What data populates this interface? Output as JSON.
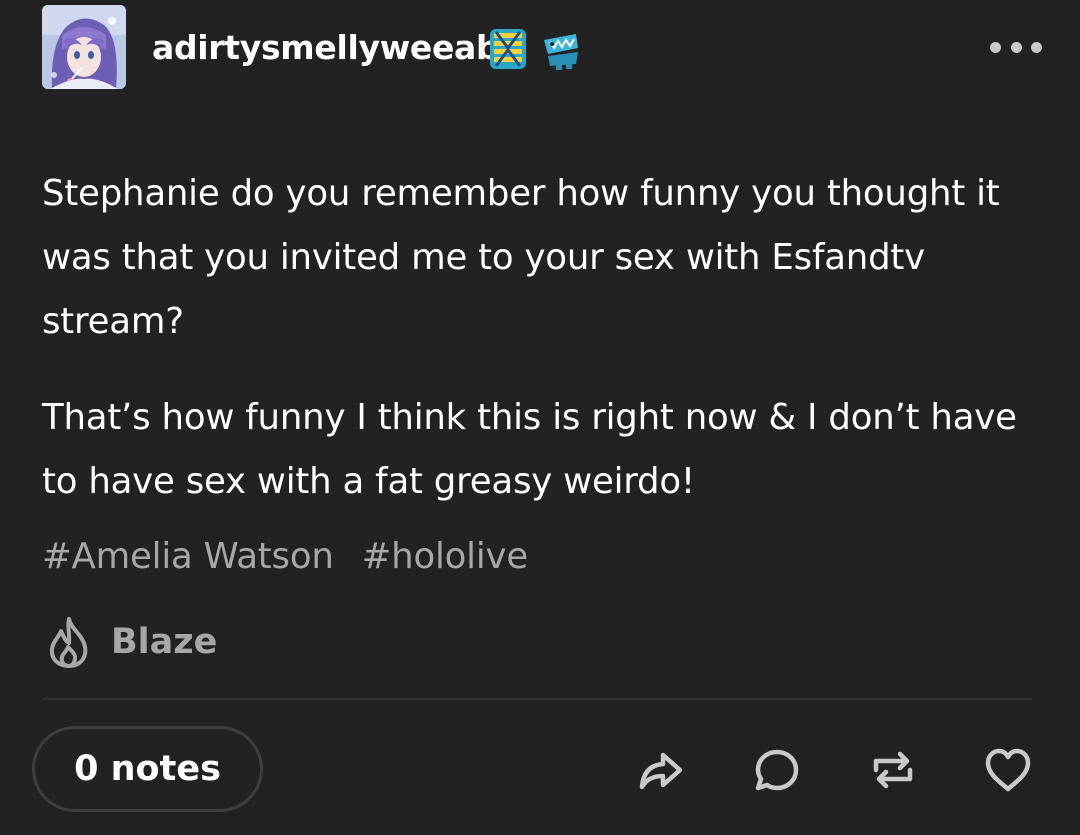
{
  "post": {
    "author": {
      "username": "adirtysmellyweeab",
      "badges": [
        "striped-badge-icon",
        "chomper-badge-icon"
      ]
    },
    "paragraphs": [
      "Stephanie do you remember how funny you thought it was that you invited me to your sex with Esfandtv stream?",
      "That’s how funny I think this is right now & I don’t have to have sex with a fat greasy weirdo!"
    ],
    "tags": [
      "#Amelia Watson",
      "#hololive"
    ],
    "blaze_label": "Blaze",
    "notes_label": "0 notes",
    "actions": [
      "share-icon",
      "reply-icon",
      "reblog-icon",
      "like-icon"
    ]
  },
  "colors": {
    "background": "#222222",
    "text": "#ffffff",
    "muted": "#a7a7a7",
    "border": "#3e3e3e"
  }
}
